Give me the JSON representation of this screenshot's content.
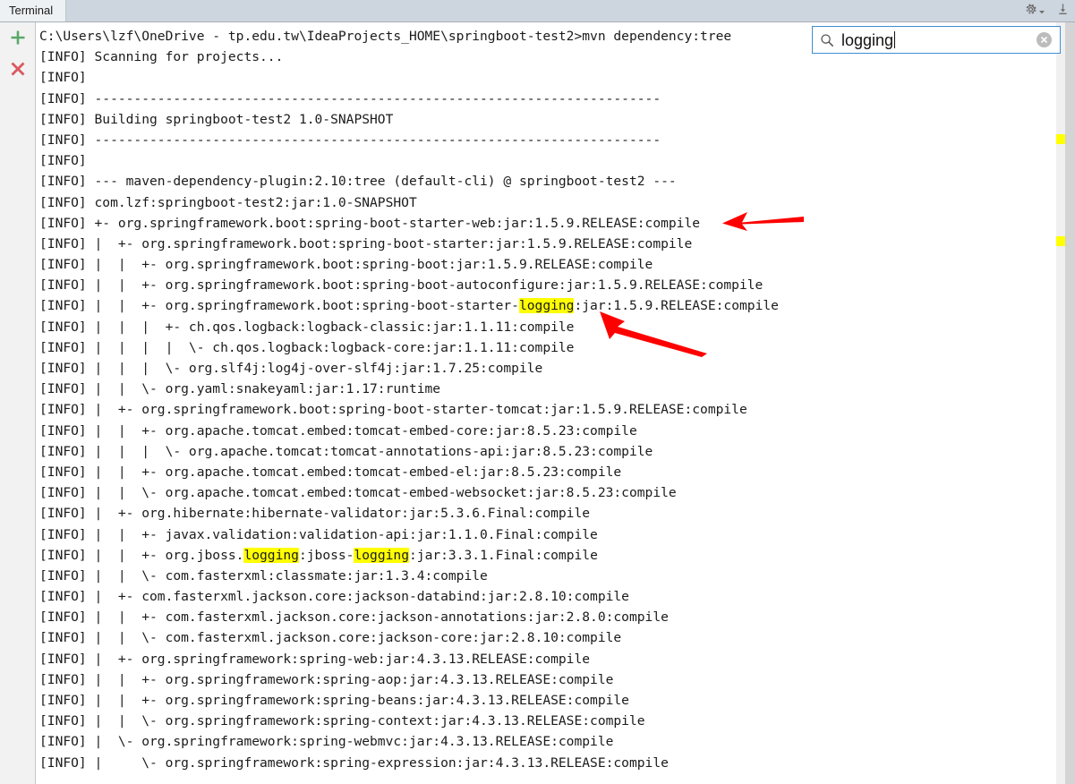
{
  "window": {
    "tool_tab_label": "Terminal",
    "titlebar_icons": [
      "gear-icon",
      "chevron-down-icon",
      "hide-icon"
    ]
  },
  "gutter": {
    "add_label": "+",
    "close_label": "×"
  },
  "search": {
    "value": "logging",
    "icon": "search-icon",
    "clear_label": "×",
    "highlight_color": "#ffff00",
    "border_color": "#3c8fd4"
  },
  "markers": {
    "color": "#ffff00",
    "positions": [
      125,
      239
    ]
  },
  "console": {
    "prompt_line": "C:\\Users\\lzf\\OneDrive - tp.edu.tw\\IdeaProjects_HOME\\springboot-test2>mvn dependency:tree",
    "lines": [
      {
        "text": "C:\\Users\\lzf\\OneDrive - tp.edu.tw\\IdeaProjects_HOME\\springboot-test2>mvn dependency:tree"
      },
      {
        "text": "[INFO] Scanning for projects..."
      },
      {
        "text": "[INFO] "
      },
      {
        "text": "[INFO] ------------------------------------------------------------------------"
      },
      {
        "text": "[INFO] Building springboot-test2 1.0-SNAPSHOT"
      },
      {
        "text": "[INFO] ------------------------------------------------------------------------"
      },
      {
        "text": "[INFO] "
      },
      {
        "text": "[INFO] --- maven-dependency-plugin:2.10:tree (default-cli) @ springboot-test2 ---"
      },
      {
        "text": "[INFO] com.lzf:springboot-test2:jar:1.0-SNAPSHOT"
      },
      {
        "text": "[INFO] +- org.springframework.boot:spring-boot-starter-web:jar:1.5.9.RELEASE:compile"
      },
      {
        "text": "[INFO] |  +- org.springframework.boot:spring-boot-starter:jar:1.5.9.RELEASE:compile"
      },
      {
        "text": "[INFO] |  |  +- org.springframework.boot:spring-boot:jar:1.5.9.RELEASE:compile"
      },
      {
        "text": "[INFO] |  |  +- org.springframework.boot:spring-boot-autoconfigure:jar:1.5.9.RELEASE:compile"
      },
      {
        "text": "[INFO] |  |  +- org.springframework.boot:spring-boot-starter-logging:jar:1.5.9.RELEASE:compile",
        "highlights": [
          "logging"
        ]
      },
      {
        "text": "[INFO] |  |  |  +- ch.qos.logback:logback-classic:jar:1.1.11:compile"
      },
      {
        "text": "[INFO] |  |  |  |  \\- ch.qos.logback:logback-core:jar:1.1.11:compile"
      },
      {
        "text": "[INFO] |  |  |  \\- org.slf4j:log4j-over-slf4j:jar:1.7.25:compile"
      },
      {
        "text": "[INFO] |  |  \\- org.yaml:snakeyaml:jar:1.17:runtime"
      },
      {
        "text": "[INFO] |  +- org.springframework.boot:spring-boot-starter-tomcat:jar:1.5.9.RELEASE:compile"
      },
      {
        "text": "[INFO] |  |  +- org.apache.tomcat.embed:tomcat-embed-core:jar:8.5.23:compile"
      },
      {
        "text": "[INFO] |  |  |  \\- org.apache.tomcat:tomcat-annotations-api:jar:8.5.23:compile"
      },
      {
        "text": "[INFO] |  |  +- org.apache.tomcat.embed:tomcat-embed-el:jar:8.5.23:compile"
      },
      {
        "text": "[INFO] |  |  \\- org.apache.tomcat.embed:tomcat-embed-websocket:jar:8.5.23:compile"
      },
      {
        "text": "[INFO] |  +- org.hibernate:hibernate-validator:jar:5.3.6.Final:compile"
      },
      {
        "text": "[INFO] |  |  +- javax.validation:validation-api:jar:1.1.0.Final:compile"
      },
      {
        "text": "[INFO] |  |  +- org.jboss.logging:jboss-logging:jar:3.3.1.Final:compile",
        "highlights": [
          "logging",
          "logging"
        ]
      },
      {
        "text": "[INFO] |  |  \\- com.fasterxml:classmate:jar:1.3.4:compile"
      },
      {
        "text": "[INFO] |  +- com.fasterxml.jackson.core:jackson-databind:jar:2.8.10:compile"
      },
      {
        "text": "[INFO] |  |  +- com.fasterxml.jackson.core:jackson-annotations:jar:2.8.0:compile"
      },
      {
        "text": "[INFO] |  |  \\- com.fasterxml.jackson.core:jackson-core:jar:2.8.10:compile"
      },
      {
        "text": "[INFO] |  +- org.springframework:spring-web:jar:4.3.13.RELEASE:compile"
      },
      {
        "text": "[INFO] |  |  +- org.springframework:spring-aop:jar:4.3.13.RELEASE:compile"
      },
      {
        "text": "[INFO] |  |  +- org.springframework:spring-beans:jar:4.3.13.RELEASE:compile"
      },
      {
        "text": "[INFO] |  |  \\- org.springframework:spring-context:jar:4.3.13.RELEASE:compile"
      },
      {
        "text": "[INFO] |  \\- org.springframework:spring-webmvc:jar:4.3.13.RELEASE:compile"
      },
      {
        "text": "[INFO] |     \\- org.springframework:spring-expression:jar:4.3.13.RELEASE:compile"
      }
    ]
  },
  "annotations": {
    "color": "#fe0000",
    "arrows": [
      {
        "name": "arrow-pointing-to-spring-boot-starter-web",
        "target_line": 9
      },
      {
        "name": "arrow-pointing-to-spring-boot-starter-logging",
        "target_line": 13
      }
    ]
  }
}
